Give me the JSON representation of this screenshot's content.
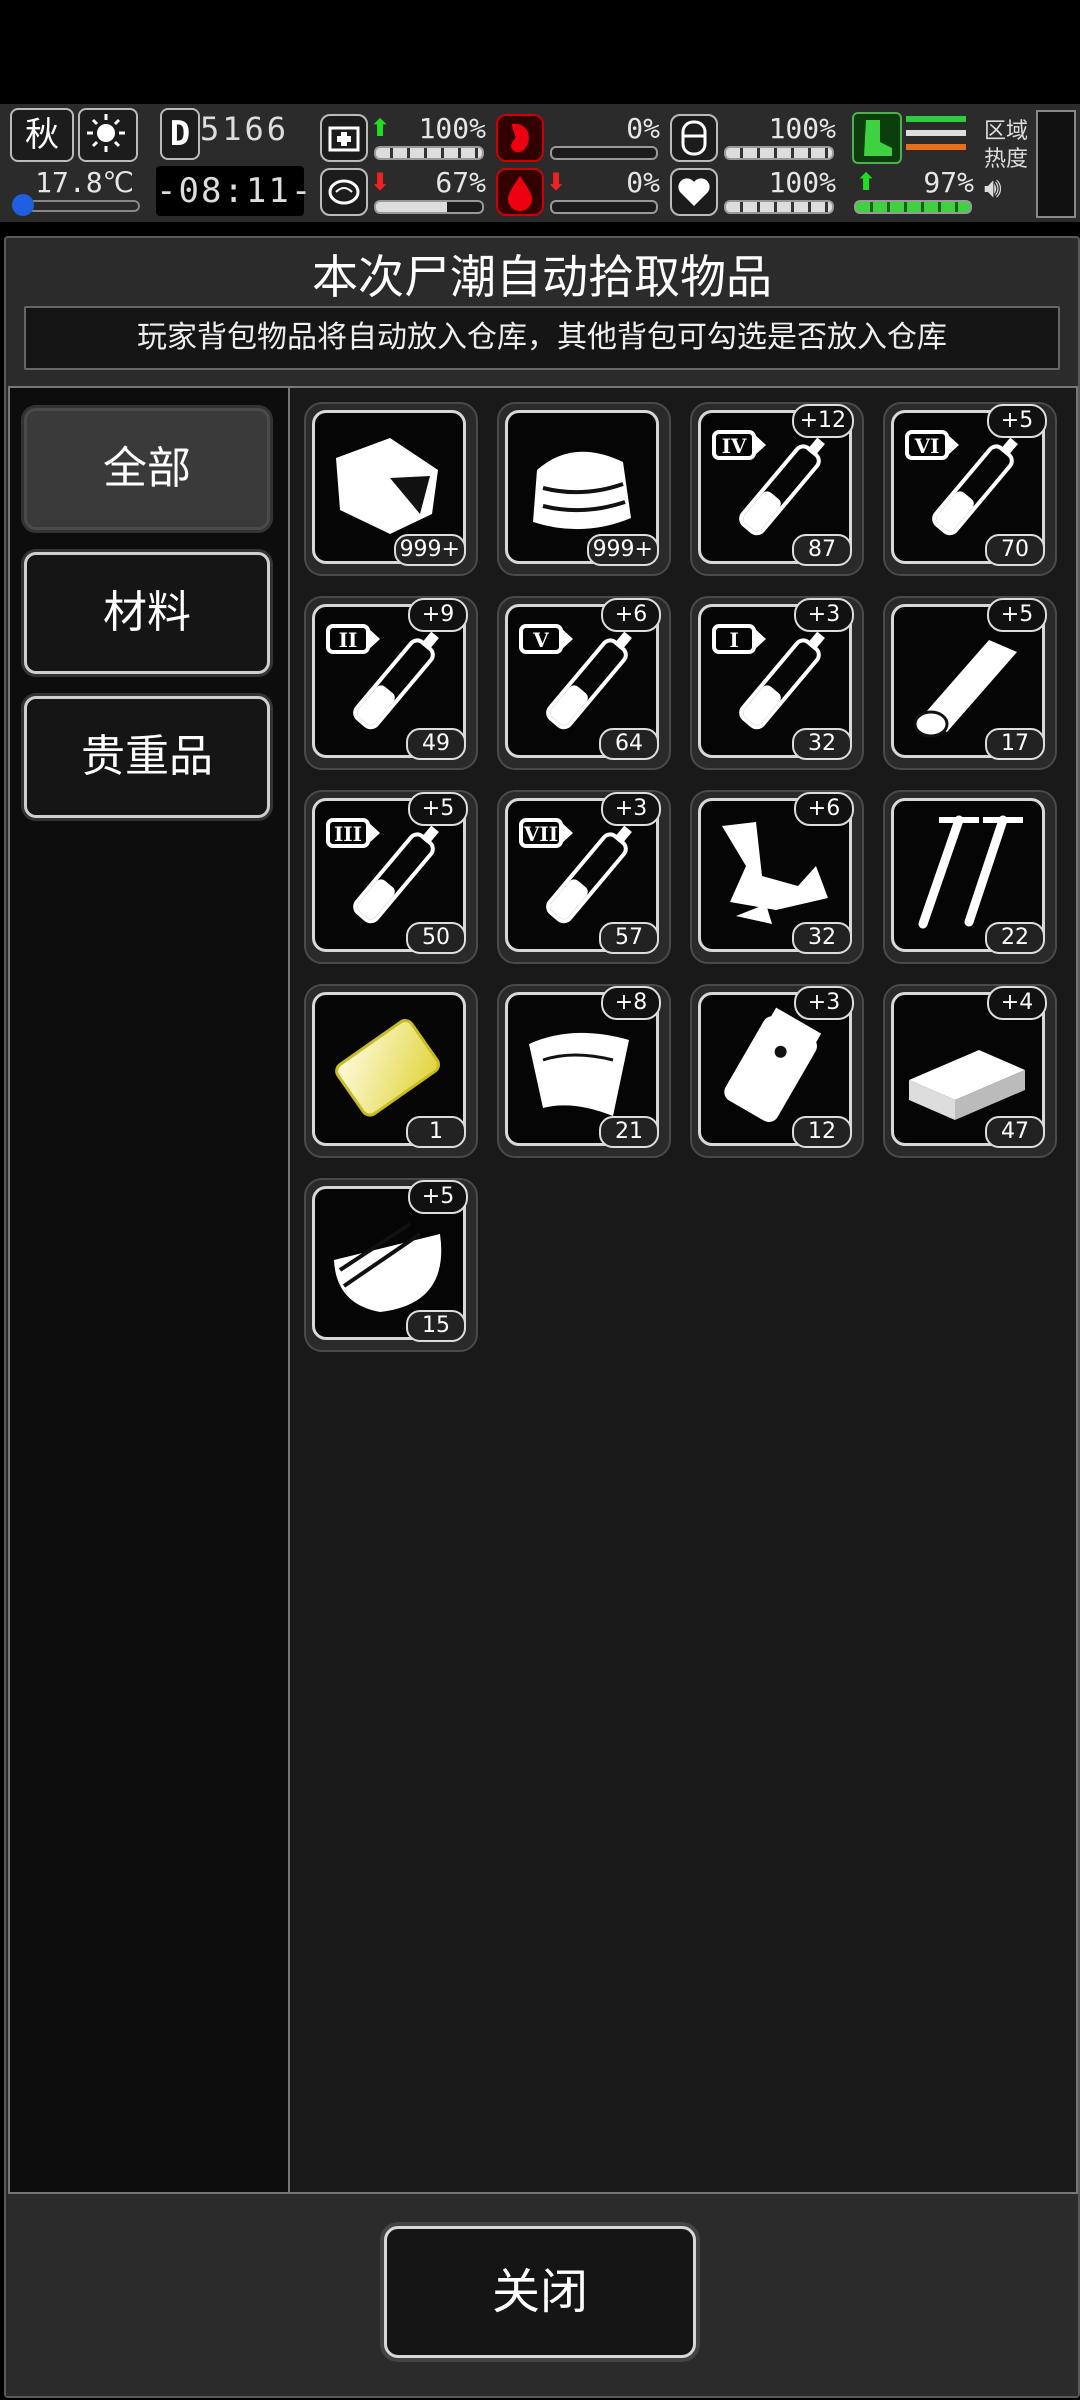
{
  "hud": {
    "season": "秋",
    "temperature": "17.8℃",
    "day_letter": "D",
    "day_number": "5166",
    "clock": "-08:11-",
    "stats": [
      {
        "icon": "medkit-icon",
        "arrow": "up",
        "value": "100%",
        "fill": 1.0
      },
      {
        "icon": "stomach-icon",
        "arrow": "",
        "value": "0%",
        "fill": 0
      },
      {
        "icon": "shield-icon",
        "arrow": "",
        "value": "100%",
        "fill": 1.0
      },
      {
        "icon": "brain-icon",
        "arrow": "down",
        "value": "67%",
        "fill": 0.67
      },
      {
        "icon": "blood-drop-icon",
        "arrow": "down",
        "value": "0%",
        "fill": 0
      },
      {
        "icon": "heart-icon",
        "arrow": "",
        "value": "100%",
        "fill": 1.0
      }
    ],
    "stamina": {
      "icon": "boot-icon",
      "value": "97%",
      "fill": 0.97
    },
    "stripe_colors": [
      "#2ecc40",
      "#dddddd",
      "#e8701a"
    ],
    "zone_label_1": "区域",
    "zone_label_2": "热度",
    "accent_green": "#22dd22",
    "accent_red": "#e22222"
  },
  "panel": {
    "title": "本次尸潮自动拾取物品",
    "notice": "玩家背包物品将自动放入仓库，其他背包可勾选是否放入仓库",
    "tabs": [
      "全部",
      "材料",
      "贵重品"
    ],
    "active_tab": "全部",
    "close_label": "关闭"
  },
  "items": [
    {
      "icon": "cloth-scrap-icon",
      "bonus": "",
      "count": "999+"
    },
    {
      "icon": "folded-cloth-icon",
      "bonus": "",
      "count": "999+"
    },
    {
      "icon": "syringe-iv-icon",
      "roman": "IV",
      "bonus": "+12",
      "count": "87"
    },
    {
      "icon": "syringe-vi-icon",
      "roman": "VI",
      "bonus": "+5",
      "count": "70"
    },
    {
      "icon": "syringe-ii-icon",
      "roman": "II",
      "bonus": "+9",
      "count": "49"
    },
    {
      "icon": "syringe-v-icon",
      "roman": "V",
      "bonus": "+6",
      "count": "64"
    },
    {
      "icon": "syringe-i-icon",
      "roman": "I",
      "bonus": "+3",
      "count": "32"
    },
    {
      "icon": "wood-log-icon",
      "bonus": "+5",
      "count": "17"
    },
    {
      "icon": "syringe-iii-icon",
      "roman": "III",
      "bonus": "+5",
      "count": "50"
    },
    {
      "icon": "syringe-vii-icon",
      "roman": "VII",
      "bonus": "+3",
      "count": "57"
    },
    {
      "icon": "scrap-parts-icon",
      "bonus": "+6",
      "count": "32"
    },
    {
      "icon": "nails-icon",
      "bonus": "",
      "count": "22"
    },
    {
      "icon": "gold-card-icon",
      "bonus": "",
      "count": "1"
    },
    {
      "icon": "leather-sheet-icon",
      "bonus": "+8",
      "count": "21"
    },
    {
      "icon": "bag-icon",
      "bonus": "+3",
      "count": "12"
    },
    {
      "icon": "brick-icon",
      "bonus": "+4",
      "count": "47"
    },
    {
      "icon": "bowl-icon",
      "bonus": "+5",
      "count": "15"
    }
  ]
}
